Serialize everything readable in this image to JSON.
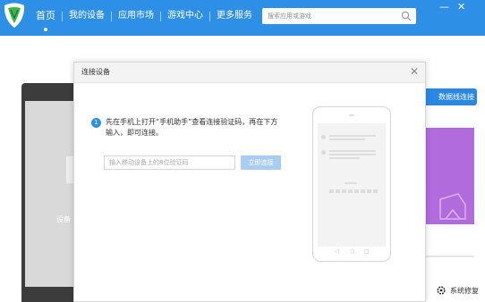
{
  "nav": {
    "items": [
      "首页",
      "我的设备",
      "应用市场",
      "游戏中心",
      "更多服务"
    ],
    "active_index": 0
  },
  "search": {
    "placeholder": "搜索应用或游戏"
  },
  "window_controls": {
    "minimize": "—",
    "close": "✕"
  },
  "background": {
    "phone_text": "设备",
    "button_label": "数据线连接",
    "repair_label": "系统修复"
  },
  "dialog": {
    "title": "连接设备",
    "close": "✕",
    "step_number": "1",
    "instruction": "先在手机上打开“手机助手”查看连接验证码，再在下方输入，即可连接。",
    "input_placeholder": "输入移动设备上的8位验证码",
    "connect_button": "立即连接"
  },
  "colors": {
    "topbar": "#2e8fe6",
    "accent": "#2e8fe6",
    "connect_button_disabled": "#a9cdf2",
    "promo_tile": "#b16bdc"
  },
  "icons": {
    "logo": "app-logo-icon",
    "search": "search-icon",
    "repair": "gear-icon"
  }
}
